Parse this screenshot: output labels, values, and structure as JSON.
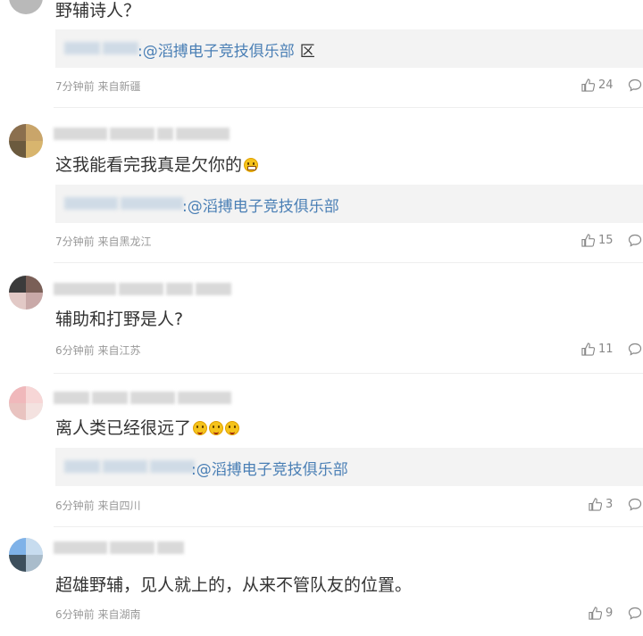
{
  "comments": [
    {
      "text": "野辅诗人？",
      "reply": {
        "mention": ":@滔搏电子竞技俱乐部",
        "suffix": "区"
      },
      "time": "7分钟前",
      "location": "来自新疆",
      "likes": "24"
    },
    {
      "text": "这我能看完我真是欠你的",
      "reply": {
        "mention": ":@滔搏电子竞技俱乐部"
      },
      "time": "7分钟前",
      "location": "来自黑龙江",
      "likes": "15"
    },
    {
      "text": "辅助和打野是人?",
      "time": "6分钟前",
      "location": "来自江苏",
      "likes": "11"
    },
    {
      "text": "离人类已经很远了",
      "reply": {
        "mention": ":@滔搏电子竞技俱乐部"
      },
      "time": "6分钟前",
      "location": "来自四川",
      "likes": "3"
    },
    {
      "text": "超雄野辅，见人就上的，从来不管队友的位置。",
      "time": "6分钟前",
      "location": "来自湖南",
      "likes": "9"
    }
  ],
  "icons": {
    "like": "thumbs-up-icon",
    "reply": "comment-bubble-icon",
    "emoji_grin": "grin-emoji-icon",
    "emoji_tongue": "tongue-emoji-icon"
  },
  "colors": {
    "link": "#4a7fb5",
    "text": "#333333",
    "meta": "#999999",
    "reply_bg": "#f3f3f3"
  }
}
